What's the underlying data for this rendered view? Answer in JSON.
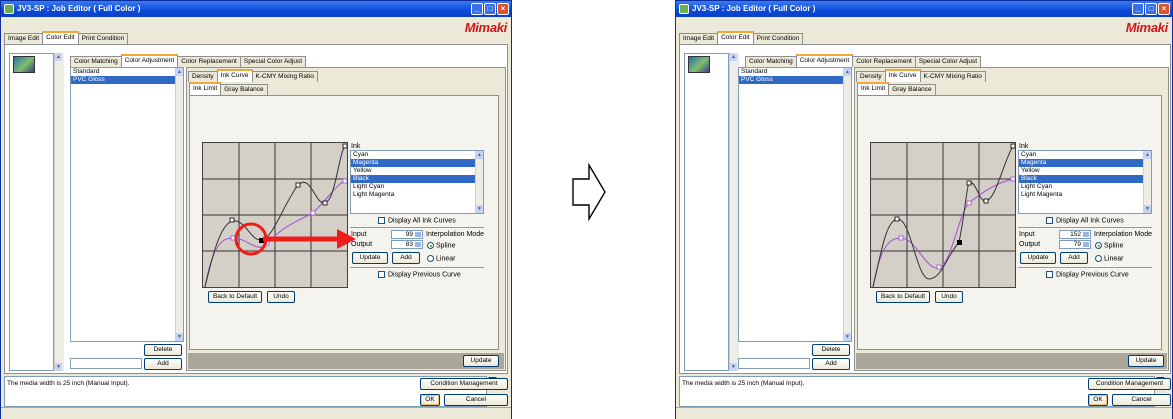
{
  "window": {
    "title": "JV3-SP : Job Editor ( Full Color )",
    "brand": "Mimaki"
  },
  "tabs_main": [
    "Image Edit",
    "Color Edit",
    "Print Condition"
  ],
  "tabs_color": [
    "Color Matching",
    "Color Adjustment",
    "Color Replacement",
    "Special Color Adjust"
  ],
  "tabs_adj": [
    "Density",
    "Ink Curve",
    "K-CMY Mixing Ratio"
  ],
  "tabs_curve": [
    "Ink Limit",
    "Gray Balance"
  ],
  "presets": [
    "Standard",
    "PVC Gloss"
  ],
  "ink": {
    "label": "Ink",
    "items": [
      "Cyan",
      "Magenta",
      "Yellow",
      "Black",
      "Light Cyan",
      "Light Magenta"
    ],
    "display_all": "Display All Ink Curves"
  },
  "fields": {
    "input_label": "Input",
    "output_label": "Output"
  },
  "interp": {
    "title": "Interpolation Mode",
    "spline": "Spline",
    "linear": "Linear"
  },
  "buttons": {
    "update": "Update",
    "add": "Add",
    "delete": "Delete",
    "back_default": "Back to Default",
    "undo": "Undo",
    "condition_mgmt": "Condition Management",
    "ok": "OK",
    "cancel": "Cancel"
  },
  "display_previous": "Display Previous Curve",
  "status_msg": "The media width is 25 inch (Manual Input).",
  "before": {
    "input": "99",
    "output": "83"
  },
  "after": {
    "input": "152",
    "output": "79"
  },
  "colors": {
    "titlebar": "#0a49d8",
    "selection": "#316ac5",
    "brand": "#d4141b",
    "arrow": "#ef1c1c"
  }
}
